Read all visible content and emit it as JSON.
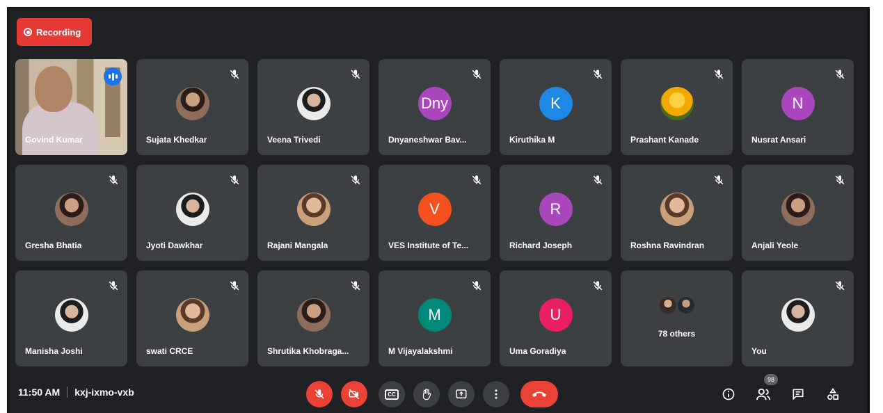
{
  "recording_label": "Recording",
  "colors": {
    "accent_red": "#ea4335",
    "active_outline": "#8ab4f8",
    "speaking_blue": "#1a73e8",
    "tile_bg": "#3c4043"
  },
  "participants": [
    {
      "name": "Govind Kumar",
      "type": "video",
      "speaking": true
    },
    {
      "name": "Sujata Khedkar",
      "type": "photo",
      "muted": true
    },
    {
      "name": "Veena Trivedi",
      "type": "photo",
      "muted": true
    },
    {
      "name": "Dnyaneshwar Bav...",
      "type": "initial",
      "initial": "Dny",
      "color": "#ab47bc",
      "muted": true
    },
    {
      "name": "Kiruthika M",
      "type": "initial",
      "initial": "K",
      "color": "#1e88e5",
      "muted": true
    },
    {
      "name": "Prashant Kanade",
      "type": "photo",
      "muted": true
    },
    {
      "name": "Nusrat Ansari",
      "type": "initial",
      "initial": "N",
      "color": "#ab47bc",
      "muted": true
    },
    {
      "name": "Gresha Bhatia",
      "type": "photo",
      "muted": true
    },
    {
      "name": "Jyoti Dawkhar",
      "type": "photo",
      "muted": true
    },
    {
      "name": "Rajani Mangala",
      "type": "photo",
      "muted": true
    },
    {
      "name": "VES Institute of Te...",
      "type": "initial",
      "initial": "V",
      "color": "#f4511e",
      "muted": true
    },
    {
      "name": "Richard Joseph",
      "type": "initial",
      "initial": "R",
      "color": "#ab47bc",
      "muted": true
    },
    {
      "name": "Roshna Ravindran",
      "type": "photo",
      "muted": true
    },
    {
      "name": "Anjali Yeole",
      "type": "photo",
      "muted": true
    },
    {
      "name": "Manisha Joshi",
      "type": "photo",
      "muted": true
    },
    {
      "name": "swati CRCE",
      "type": "photo",
      "muted": true
    },
    {
      "name": "Shrutika Khobraga...",
      "type": "photo",
      "muted": true
    },
    {
      "name": "M Vijayalakshmi",
      "type": "initial",
      "initial": "M",
      "color": "#00897b",
      "muted": true
    },
    {
      "name": "Uma Goradiya",
      "type": "initial",
      "initial": "U",
      "color": "#e91e63",
      "muted": true
    },
    {
      "name": "78 others",
      "type": "others",
      "muted": false
    },
    {
      "name": "You",
      "type": "photo",
      "muted": true
    }
  ],
  "bottom_bar": {
    "time": "11:50 AM",
    "meeting_code": "kxj-ixmo-vxb",
    "participants_count": "98",
    "controls": [
      "mic-off",
      "camera-off",
      "captions",
      "raise-hand",
      "present",
      "more-options",
      "leave-call"
    ],
    "cc_label": "CC"
  }
}
